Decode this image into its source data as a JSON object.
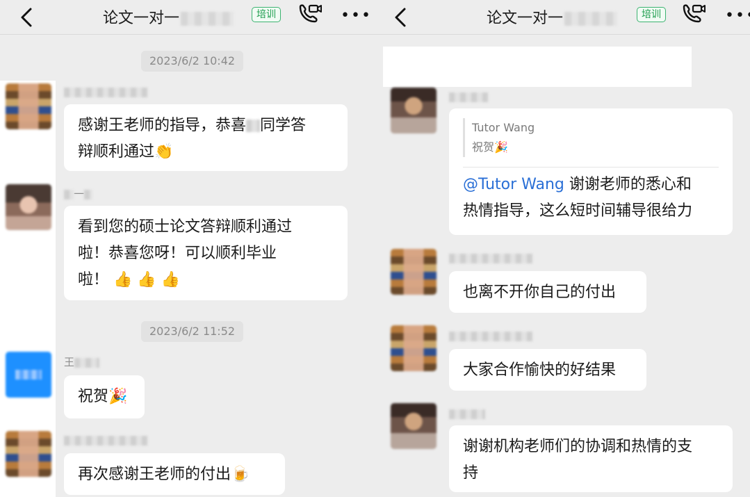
{
  "header": {
    "title": "论文一对一",
    "badge": "培训"
  },
  "left": {
    "timestamps": [
      "2023/6/2 10:42",
      "2023/6/2 11:52"
    ],
    "messages": [
      {
        "lines": [
          "感谢王老师的指导，恭喜",
          "辩顺利通过👏"
        ],
        "mid": "同学答"
      },
      {
        "sender": "一",
        "lines": [
          "看到您的硕士论文答辩顺利通过",
          "啦！恭喜您呀！可以顺利毕业",
          "啦！ 👍 👍 👍"
        ]
      },
      {
        "sender": "王",
        "lines": [
          "祝贺🎉"
        ]
      },
      {
        "lines": [
          "再次感谢王老师的付出🍺"
        ]
      }
    ]
  },
  "right": {
    "quote": {
      "author": "Tutor Wang",
      "text": "祝贺🎉"
    },
    "reply": {
      "mention": "@Tutor Wang",
      "line1_rest": " 谢谢老师的悉心和",
      "line2": "热情指导，这么短时间辅导很给力"
    },
    "messages": [
      {
        "lines": [
          "也离不开你自己的付出"
        ]
      },
      {
        "lines": [
          "大家合作愉快的好结果"
        ]
      },
      {
        "lines": [
          "谢谢机构老师们的协调和热情的支",
          "持"
        ]
      }
    ]
  },
  "colors": {
    "background": "#ededed",
    "bubble": "#ffffff",
    "badge_green": "#1f9e4f",
    "mention_blue": "#2a6fd6"
  }
}
